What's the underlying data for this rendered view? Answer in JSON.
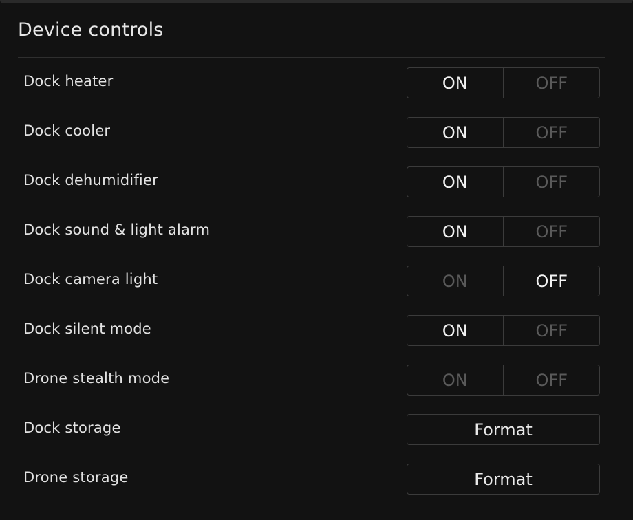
{
  "panel": {
    "title": "Device controls"
  },
  "toggles": [
    {
      "label": "Dock heater",
      "on_label": "ON",
      "off_label": "OFF",
      "state": "on"
    },
    {
      "label": "Dock cooler",
      "on_label": "ON",
      "off_label": "OFF",
      "state": "on"
    },
    {
      "label": "Dock dehumidifier",
      "on_label": "ON",
      "off_label": "OFF",
      "state": "on"
    },
    {
      "label": "Dock sound & light alarm",
      "on_label": "ON",
      "off_label": "OFF",
      "state": "on"
    },
    {
      "label": "Dock camera light",
      "on_label": "ON",
      "off_label": "OFF",
      "state": "off"
    },
    {
      "label": "Dock silent mode",
      "on_label": "ON",
      "off_label": "OFF",
      "state": "on"
    },
    {
      "label": "Drone stealth mode",
      "on_label": "ON",
      "off_label": "OFF",
      "state": "none"
    }
  ],
  "storage": [
    {
      "label": "Dock storage",
      "button_label": "Format"
    },
    {
      "label": "Drone storage",
      "button_label": "Format"
    }
  ],
  "colors": {
    "background": "#121212",
    "active_text": "#f2f2f2",
    "inactive_text": "#5a5a5a",
    "border": "#3b3b3b"
  }
}
